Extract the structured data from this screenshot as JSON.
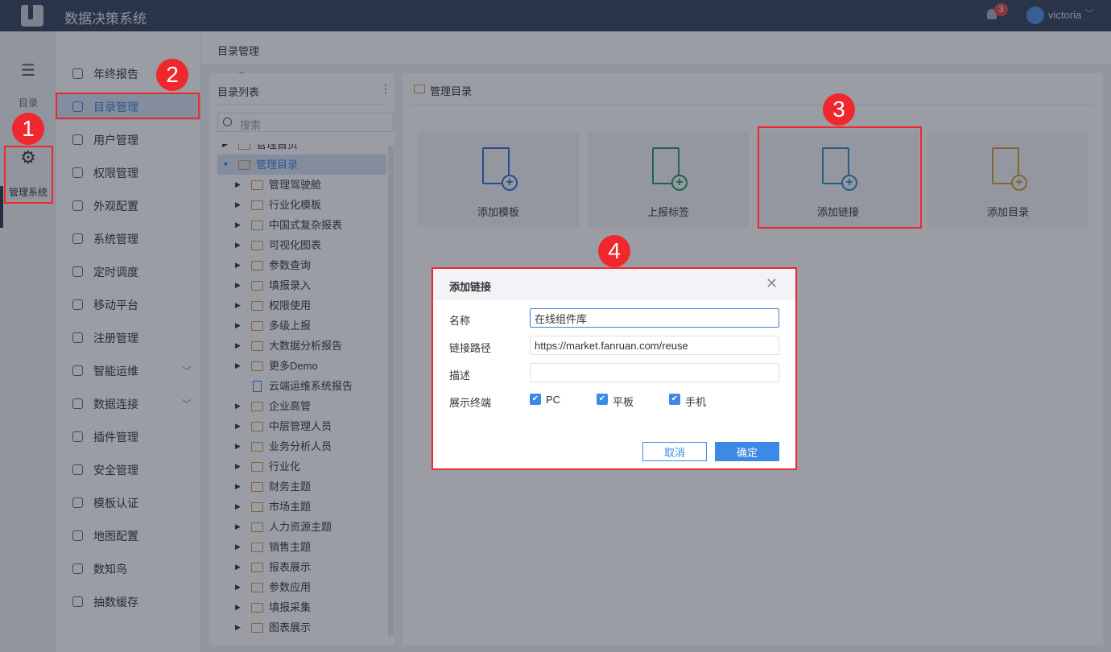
{
  "header": {
    "app_title": "数据决策系统",
    "notifications": "3",
    "user": "victoria"
  },
  "rail": {
    "items": [
      {
        "label": "目录",
        "icon": "list-icon"
      },
      {
        "label": "管理系统",
        "icon": "gear-icon"
      }
    ]
  },
  "menu": {
    "items": [
      {
        "label": "年终报告"
      },
      {
        "label": "目录管理",
        "active": true
      },
      {
        "label": "用户管理"
      },
      {
        "label": "权限管理"
      },
      {
        "label": "外观配置"
      },
      {
        "label": "系统管理"
      },
      {
        "label": "定时调度"
      },
      {
        "label": "移动平台"
      },
      {
        "label": "注册管理"
      },
      {
        "label": "智能运维",
        "expandable": true
      },
      {
        "label": "数据连接",
        "expandable": true
      },
      {
        "label": "插件管理"
      },
      {
        "label": "安全管理"
      },
      {
        "label": "模板认证"
      },
      {
        "label": "地图配置"
      },
      {
        "label": "数知鸟"
      },
      {
        "label": "抽数缓存"
      }
    ]
  },
  "breadcrumb": "目录管理",
  "tree": {
    "title": "目录列表",
    "search_placeholder": "搜索",
    "items": [
      {
        "label": "管理首页",
        "level": 0
      },
      {
        "label": "管理目录",
        "level": 0,
        "expanded": true,
        "selected": true
      },
      {
        "label": "管理驾驶舱"
      },
      {
        "label": "行业化模板"
      },
      {
        "label": "中国式复杂报表"
      },
      {
        "label": "可视化图表"
      },
      {
        "label": "参数查询"
      },
      {
        "label": "填报录入"
      },
      {
        "label": "权限使用"
      },
      {
        "label": "多级上报"
      },
      {
        "label": "大数据分析报告"
      },
      {
        "label": "更多Demo"
      },
      {
        "label": "云端运维系统报告",
        "type": "file"
      },
      {
        "label": "企业高管"
      },
      {
        "label": "中层管理人员"
      },
      {
        "label": "业务分析人员"
      },
      {
        "label": "行业化"
      },
      {
        "label": "财务主题"
      },
      {
        "label": "市场主题"
      },
      {
        "label": "人力资源主题"
      },
      {
        "label": "销售主题"
      },
      {
        "label": "报表展示"
      },
      {
        "label": "参数应用"
      },
      {
        "label": "填报采集"
      },
      {
        "label": "图表展示"
      }
    ]
  },
  "content": {
    "title": "管理目录",
    "cards": [
      {
        "label": "添加模板",
        "icon": "add-template-icon",
        "color": "#2f6fd0"
      },
      {
        "label": "上报标签",
        "icon": "report-tag-icon",
        "color": "#1f9a55"
      },
      {
        "label": "添加链接",
        "icon": "add-link-icon",
        "color": "#2a8ac0"
      },
      {
        "label": "添加目录",
        "icon": "add-folder-icon",
        "color": "#d39a3a"
      }
    ]
  },
  "modal": {
    "title": "添加链接",
    "fields": {
      "name_label": "名称",
      "name_value": "在线组件库",
      "path_label": "链接路径",
      "path_value": "https://market.fanruan.com/reuse",
      "desc_label": "描述",
      "desc_value": "",
      "terminal_label": "展示终端"
    },
    "terminals": [
      {
        "label": "PC",
        "checked": true
      },
      {
        "label": "平板",
        "checked": true
      },
      {
        "label": "手机",
        "checked": true
      }
    ],
    "cancel": "取消",
    "ok": "确定"
  },
  "annotations": [
    "1",
    "2",
    "3",
    "4"
  ],
  "colors": {
    "accent": "#3d8ae6",
    "annotation": "#f0282d",
    "header": "#34405a"
  }
}
